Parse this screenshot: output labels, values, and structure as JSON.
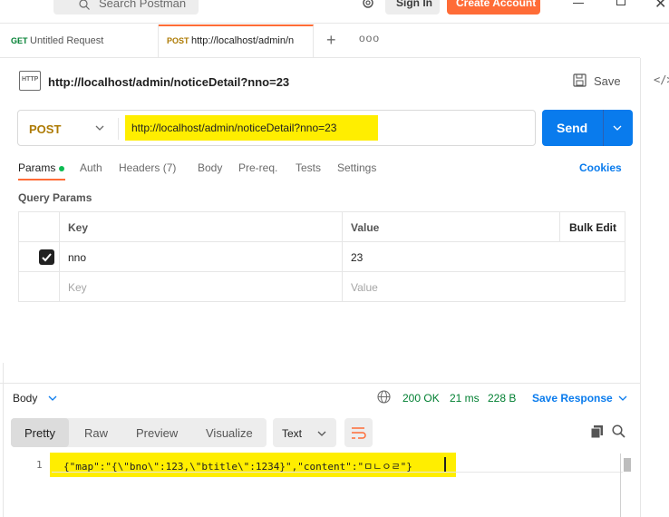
{
  "topbar": {
    "search_placeholder": "Search Postman",
    "signin_label": "Sign In",
    "create_account_label": "Create Account"
  },
  "tabs": [
    {
      "method": "GET",
      "title": "Untitled Request"
    },
    {
      "method": "POST",
      "title": "http://localhost/admin/n"
    }
  ],
  "tab_more": "ooo",
  "tab_add": "+",
  "request": {
    "icon_label": "HTTP",
    "title": "http://localhost/admin/noticeDetail?nno=23",
    "save_label": "Save",
    "method": "POST",
    "url": "http://localhost/admin/noticeDetail?nno=23",
    "send_label": "Send"
  },
  "request_tabs": {
    "params": "Params",
    "auth": "Auth",
    "headers": "Headers (7)",
    "body": "Body",
    "prereq": "Pre-req.",
    "tests": "Tests",
    "settings": "Settings",
    "cookies": "Cookies"
  },
  "query_params": {
    "label": "Query Params",
    "col_key": "Key",
    "col_value": "Value",
    "bulk_edit": "Bulk Edit",
    "rows": [
      {
        "key": "nno",
        "value": "23",
        "checked": true
      }
    ],
    "placeholder_key": "Key",
    "placeholder_value": "Value"
  },
  "response": {
    "body_label": "Body",
    "status": "200 OK",
    "time": "21 ms",
    "size": "228 B",
    "save_response": "Save Response",
    "views": [
      "Pretty",
      "Raw",
      "Preview",
      "Visualize"
    ],
    "format": "Text",
    "line_number": "1",
    "code": "{\"map\":\"{\\\"bno\\\":123,\\\"btitle\\\":1234}\",\"content\":\"ㅁㄴㅇㄹ\"}"
  },
  "sidebar": {
    "code_icon": "</>"
  },
  "colors": {
    "accent": "#ff6c37",
    "send": "#097bed",
    "highlight": "#ffee00",
    "ok": "#007f31",
    "post": "#ad7a03"
  }
}
